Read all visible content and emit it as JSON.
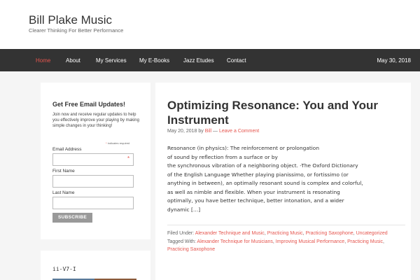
{
  "header": {
    "title": "Bill Plake Music",
    "description": "Clearer Thinking For Better Performance"
  },
  "nav": {
    "items": [
      {
        "label": "Home"
      },
      {
        "label": "About"
      },
      {
        "label": "My Services"
      },
      {
        "label": "My E-Books"
      },
      {
        "label": "Jazz Etudes"
      },
      {
        "label": "Contact"
      }
    ],
    "date": "May 30, 2018"
  },
  "sidebar": {
    "title": "Get Free Email Updates!",
    "text": "Join now and receive regular updates to help you effectively improve your playing by making simple changes in your thinking!",
    "required_note": "indicates required",
    "required_mark": "*",
    "fields": {
      "email": "Email Address",
      "first_name": "First Name",
      "last_name": "Last Name"
    },
    "subscribe": "SUBSCRIBE"
  },
  "sidebar2": {
    "title": "ii-V7-I"
  },
  "post": {
    "title": "Optimizing Resonance: You and Your Instrument",
    "date": "May 20, 2018",
    "by": "by",
    "author": "Bill",
    "separator": "—",
    "comment_link": "Leave a Comment",
    "body_lines": [
      "Resonance (in physics): The reinforcement or prolongation",
      "of sound by reflection from a surface or by",
      "the synchronous vibration of a neighboring object. -The Oxford Dictionary",
      "of the English Language Whether playing pianissimo, or fortissimo (or",
      "anything in between), an optimally resonant sound is complex and colorful,",
      "as well as nimble and flexible. When your instrument is resonating",
      "optimally, you have better technique, better intonation, and a wider",
      "dynamic […]"
    ],
    "filed_under_label": "Filed Under:",
    "categories": [
      "Alexander Technique and Music",
      "Practicing Music",
      "Practicing Saxophone",
      "Uncategorized"
    ],
    "tagged_with_label": "Tagged With:",
    "tags": [
      "Alexander Technique for Musicians",
      "Improving Musical Performance",
      "Practicing Music",
      "Practicing Saxophone"
    ]
  },
  "colors": {
    "accent": "#e5554e",
    "nav_bg": "#333333",
    "page_bg": "#f5f5f5"
  }
}
